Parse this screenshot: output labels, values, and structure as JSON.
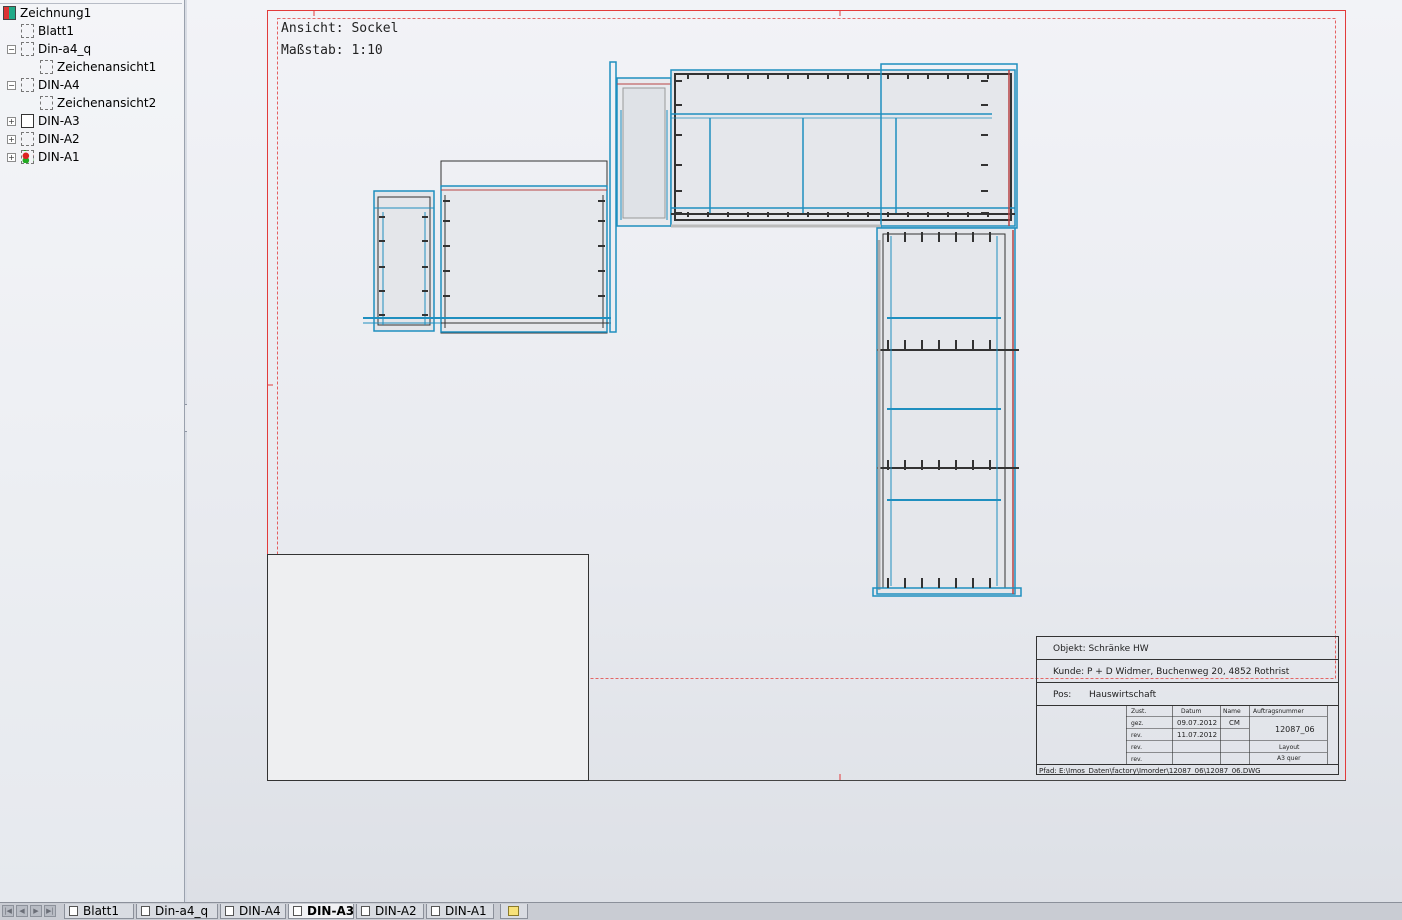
{
  "tree": {
    "items": [
      {
        "label": "Zeichnung1",
        "level": 0,
        "expander": "none",
        "icon": "drawing-icon"
      },
      {
        "label": "Blatt1",
        "level": 1,
        "expander": "none",
        "icon": "sheet-icon"
      },
      {
        "label": "Din-a4_q",
        "level": 1,
        "expander": "−",
        "icon": "sheet-icon"
      },
      {
        "label": "Zeichenansicht1",
        "level": 2,
        "expander": "none",
        "icon": "view-icon"
      },
      {
        "label": "DIN-A4",
        "level": 1,
        "expander": "−",
        "icon": "sheet-icon"
      },
      {
        "label": "Zeichenansicht2",
        "level": 2,
        "expander": "none",
        "icon": "view-icon"
      },
      {
        "label": "DIN-A3",
        "level": 1,
        "expander": "+",
        "icon": "active-sheet-icon"
      },
      {
        "label": "DIN-A2",
        "level": 1,
        "expander": "+",
        "icon": "sheet-icon"
      },
      {
        "label": "DIN-A1",
        "level": 1,
        "expander": "+",
        "icon": "sheet-warning-icon"
      }
    ]
  },
  "sheet": {
    "view_name": "Ansicht:  Sockel",
    "scale": "Maßstab: 1:10",
    "colors": {
      "border": "#e23b3b",
      "part": "#1f8fbf",
      "edge": "#333333"
    }
  },
  "title_block": {
    "objekt": "Objekt: Schränke HW",
    "kunde": "Kunde:  P + D Widmer, Buchenweg 20, 4852 Rothrist",
    "pos_label": "Pos:",
    "pos_value": "Hauswirtschaft",
    "col_datum": "Datum",
    "col_name": "Name",
    "col_auftrag": "Auftragsnummer",
    "row_zust": "Zust.",
    "row_gez": "gez.",
    "row_rev1": "rev.",
    "row_rev2": "rev.",
    "row_rev3": "rev.",
    "date_gez": "09.07.2012",
    "date_rev1": "11.07.2012",
    "name_gez": "CM",
    "auftrag": "12087_06",
    "layout_label": "Layout",
    "layout_value": "A3  quer",
    "pfad": "Pfad: E:\\Imos_Daten\\factory\\Imorder\\12087_06\\12087_06.DWG"
  },
  "tabs": {
    "items": [
      {
        "label": "Blatt1",
        "active": false
      },
      {
        "label": "Din-a4_q",
        "active": false
      },
      {
        "label": "DIN-A4",
        "active": false
      },
      {
        "label": "DIN-A3",
        "active": true
      },
      {
        "label": "DIN-A2",
        "active": false
      },
      {
        "label": "DIN-A1",
        "active": false
      }
    ]
  }
}
